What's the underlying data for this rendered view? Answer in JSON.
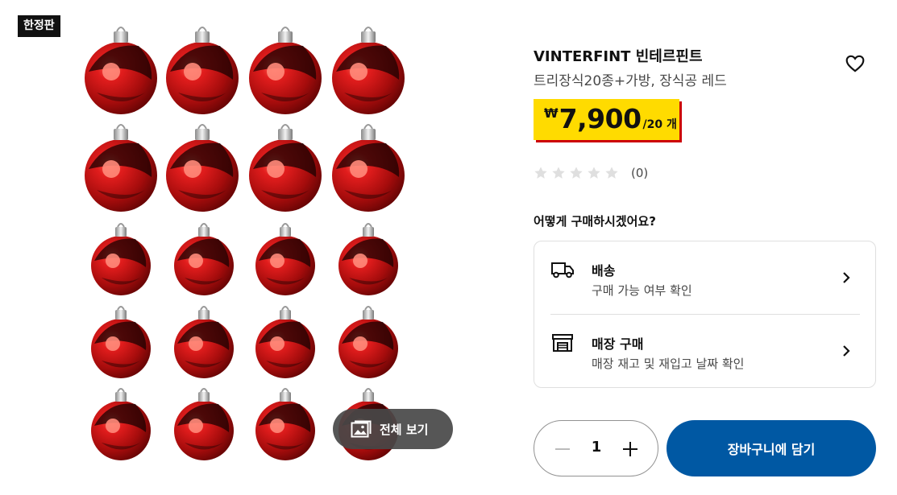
{
  "badge": {
    "label": "한정판"
  },
  "gallery": {
    "view_all_label": "전체 보기"
  },
  "product": {
    "name": "VINTERFINT 빈테르핀트",
    "description": "트리장식20종+가방, 장식공 레드",
    "price": {
      "currency": "₩",
      "value": "7,900",
      "unit": "/20 개"
    },
    "rating": {
      "stars_filled": 0,
      "stars_total": 5,
      "count_label": "(0)"
    }
  },
  "purchase": {
    "question": "어떻게 구매하시겠어요?",
    "options": [
      {
        "title": "배송",
        "subtitle": "구매 가능 여부 확인",
        "icon": "truck-icon"
      },
      {
        "title": "매장 구매",
        "subtitle": "매장 재고 및 재입고 날짜 확인",
        "icon": "store-icon"
      }
    ]
  },
  "quantity": {
    "value": "1"
  },
  "cart": {
    "add_label": "장바구니에 담기"
  },
  "colors": {
    "price_bg": "#ffdb00",
    "price_shadow": "#cc0008",
    "primary_button": "#0058a3",
    "ornament_red": "#d11a1a"
  }
}
